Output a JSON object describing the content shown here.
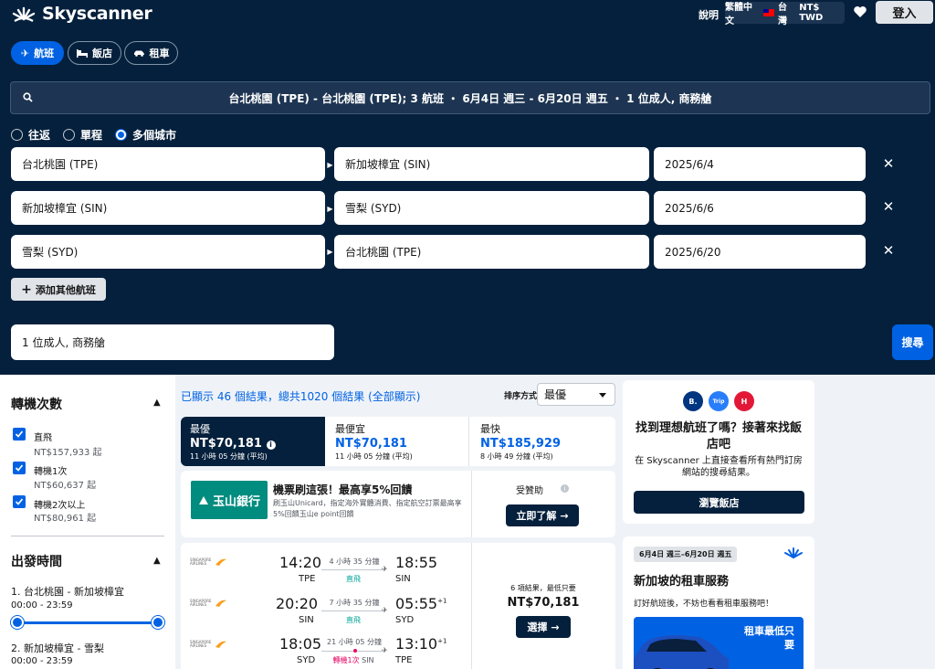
{
  "header": {
    "brand": "Skyscanner",
    "help": "說明",
    "language": "繁體中文",
    "region": "台灣",
    "currency": "NT$ TWD",
    "login": "登入"
  },
  "product_tabs": [
    "航班",
    "飯店",
    "租車"
  ],
  "search_summary": "台北桃園 (TPE) - 台北桃園 (TPE); 3 航班 ・ 6月4日 週三 - 6月20日 週五 ・ 1 位成人, 商務艙",
  "trip_types": [
    "往返",
    "單程",
    "多個城市"
  ],
  "selected_trip_type": "多個城市",
  "legs": [
    {
      "from": "台北桃園 (TPE)",
      "to": "新加坡樟宜 (SIN)",
      "date": "2025/6/4"
    },
    {
      "from": "新加坡樟宜 (SIN)",
      "to": "雪梨 (SYD)",
      "date": "2025/6/6"
    },
    {
      "from": "雪梨 (SYD)",
      "to": "台北桃園 (TPE)",
      "date": "2025/6/20"
    }
  ],
  "add_flight": "添加其他航班",
  "travellers": "1 位成人, 商務艙",
  "search_button": "搜尋",
  "filters": {
    "stops_title": "轉機次數",
    "stops": [
      {
        "label": "直飛",
        "price": "NT$157,933 起"
      },
      {
        "label": "轉機1次",
        "price": "NT$60,637 起"
      },
      {
        "label": "轉機2次以上",
        "price": "NT$80,961 起"
      }
    ],
    "depart_title": "出發時間",
    "depart_routes": [
      {
        "route": "1. 台北桃園 - 新加坡樟宜",
        "range": "00:00 - 23:59"
      },
      {
        "route": "2. 新加坡樟宜 - 雪梨",
        "range": "00:00 - 23:59"
      }
    ]
  },
  "results": {
    "shown": "已顯示 46 個結果，總共1020 個結果 (全部顯示)",
    "sort_label": "排序方式",
    "sort_value": "最優",
    "sort_tabs": [
      {
        "title": "最優",
        "price": "NT$70,181",
        "detail": "11 小時 05 分鐘 (平均)"
      },
      {
        "title": "最便宜",
        "price": "NT$70,181",
        "detail": "11 小時 05 分鐘 (平均)"
      },
      {
        "title": "最快",
        "price": "NT$185,929",
        "detail": "8 小時 49 分鐘 (平均)"
      }
    ]
  },
  "ad": {
    "bank": "玉山銀行",
    "title": "機票刷這張！最高享5%回饋",
    "desc": "刷玉山Unicard，指定海外實體消費、指定航空訂票最高享5%回饋玉山e point回饋",
    "sponsored": "受贊助",
    "cta": "立即了解"
  },
  "flight": {
    "airline": "SINGAPORE AIRLINES",
    "legs": [
      {
        "dep": "14:20",
        "dep_ap": "TPE",
        "arr": "18:55",
        "arr_sup": "",
        "arr_ap": "SIN",
        "duration": "4 小時 35 分鐘",
        "stops": "直飛"
      },
      {
        "dep": "20:20",
        "dep_ap": "SIN",
        "arr": "05:55",
        "arr_sup": "+1",
        "arr_ap": "SYD",
        "duration": "7 小時 35 分鐘",
        "stops": "直飛"
      },
      {
        "dep": "18:05",
        "dep_ap": "SYD",
        "arr": "13:10",
        "arr_sup": "+1",
        "arr_ap": "TPE",
        "duration": "21 小時 05 分鐘",
        "stops": "轉機1次",
        "via": "SIN"
      }
    ],
    "offers": "6 項結果，最低只要",
    "price": "NT$70,181",
    "select": "選擇"
  },
  "hotel_card": {
    "icons": [
      "B.",
      "Trip",
      "H"
    ],
    "title": "找到理想航班了嗎？接著來找飯店吧",
    "desc": "在 Skyscanner 上直接查看所有熱門訂房網站的搜尋結果。",
    "button": "瀏覽飯店"
  },
  "car_card": {
    "dates": "6月4日 週三–6月20日 週五",
    "title": "新加坡的租車服務",
    "desc": "訂好航班後，不妨也看看租車服務吧！",
    "promo": "租車最低只要"
  },
  "colors": {
    "navy": "#05203c",
    "blue": "#0062e3",
    "direct": "#00a698",
    "transfer": "#e70866"
  }
}
